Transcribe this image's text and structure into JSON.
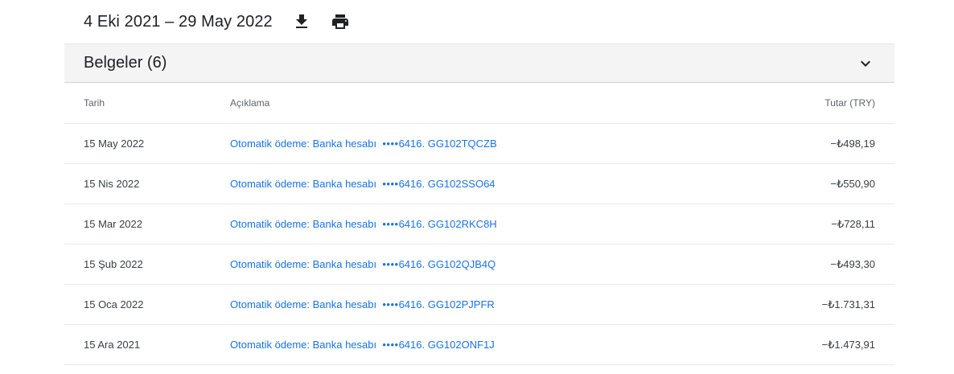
{
  "header": {
    "date_range": "4 Eki 2021 – 29 May 2022",
    "download_icon": "download-icon",
    "print_icon": "print-icon"
  },
  "section": {
    "title": "Belgeler (6)",
    "toggle_icon": "chevron-down-icon"
  },
  "table": {
    "columns": {
      "date": "Tarih",
      "description": "Açıklama",
      "amount": "Tutar (TRY)"
    },
    "rows": [
      {
        "date": "15 May 2022",
        "desc_prefix": "Otomatik ödeme: Banka hesabı",
        "masked": "••••",
        "desc_suffix": "6416. GG102TQCZB",
        "amount": "−₺498,19"
      },
      {
        "date": "15 Nis 2022",
        "desc_prefix": "Otomatik ödeme: Banka hesabı",
        "masked": "••••",
        "desc_suffix": "6416. GG102SSO64",
        "amount": "−₺550,90"
      },
      {
        "date": "15 Mar 2022",
        "desc_prefix": "Otomatik ödeme: Banka hesabı",
        "masked": "••••",
        "desc_suffix": "6416. GG102RKC8H",
        "amount": "−₺728,11"
      },
      {
        "date": "15 Şub 2022",
        "desc_prefix": "Otomatik ödeme: Banka hesabı",
        "masked": "••••",
        "desc_suffix": "6416. GG102QJB4Q",
        "amount": "−₺493,30"
      },
      {
        "date": "15 Oca 2022",
        "desc_prefix": "Otomatik ödeme: Banka hesabı",
        "masked": "••••",
        "desc_suffix": "6416. GG102PJPFR",
        "amount": "−₺1.731,31"
      },
      {
        "date": "15 Ara 2021",
        "desc_prefix": "Otomatik ödeme: Banka hesabı",
        "masked": "••••",
        "desc_suffix": "6416. GG102ONF1J",
        "amount": "−₺1.473,91"
      }
    ]
  },
  "colors": {
    "link": "#1a73e8",
    "section_bg": "#f4f4f4",
    "text": "#202124"
  }
}
